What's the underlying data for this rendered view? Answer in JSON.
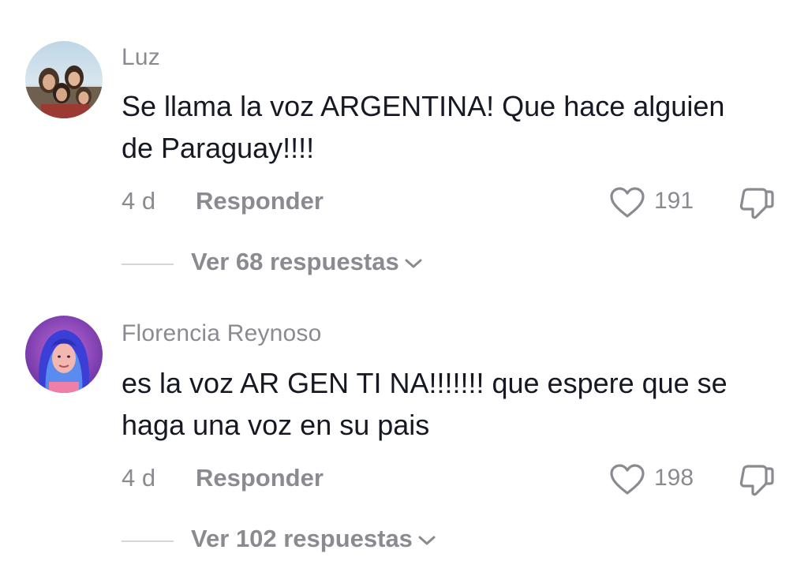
{
  "comments": [
    {
      "username": "Luz",
      "text": "Se llama la voz ARGENTINA! Que hace alguien de Paraguay!!!!",
      "time": "4 d",
      "reply_label": "Responder",
      "likes": "191",
      "view_replies": "Ver 68 respuestas",
      "avatar_icon": "group-photo-avatar"
    },
    {
      "username": "Florencia Reynoso",
      "text": "es la voz AR GEN TI NA!!!!!!! que espere que se haga una voz en su pais",
      "time": "4 d",
      "reply_label": "Responder",
      "likes": "198",
      "view_replies": "Ver 102 respuestas",
      "avatar_icon": "portrait-avatar"
    }
  ],
  "icons": {
    "like": "heart-icon",
    "dislike": "thumbs-down-icon",
    "expand": "chevron-down-icon"
  },
  "colors": {
    "primary_text": "#161823",
    "secondary_text": "#8a8b91",
    "divider": "#d5d6d8"
  }
}
